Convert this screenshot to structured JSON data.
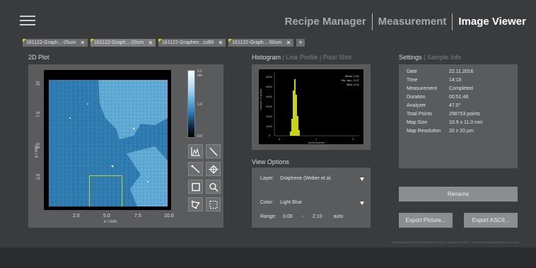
{
  "header": {
    "nav": [
      {
        "label": "Recipe Manager",
        "active": false
      },
      {
        "label": "Measurement",
        "active": false
      },
      {
        "label": "Image Viewer",
        "active": true
      }
    ]
  },
  "tabs": [
    {
      "label": "161122-Graph...-25um",
      "active": false
    },
    {
      "label": "161122-Graph...-20um",
      "active": true
    },
    {
      "label": "161122-Graphen...ssBlt",
      "active": false
    },
    {
      "label": "161122-Graph...-50um",
      "active": false
    }
  ],
  "tab_add_label": "+",
  "tab_close_label": "✕",
  "plot": {
    "title": "2D Plot",
    "y_ticks": [
      "10",
      "7.5",
      "5.0",
      "2.5"
    ],
    "x_ticks": [
      "2.5",
      "5.0",
      "7.5",
      "10.0"
    ],
    "y_title": "y / mm",
    "x_title": "x / mm",
    "colorbar_top": "2.1",
    "colorbar_unit": "nm",
    "colorbar_mid": "1.0",
    "colorbar_bottom": "0.0"
  },
  "histogram": {
    "tabs": [
      "Histogram",
      "Line Profile",
      "Pixel Shot"
    ],
    "stats": [
      "Mean: 0.01",
      "Std. dev.: 0.07",
      "Med: 0.01"
    ],
    "y_title": "Number of points",
    "x_title": "thickness/nm",
    "y_ticks": [
      "6000",
      "5000",
      "4000",
      "3000",
      "2000",
      "1000",
      "0"
    ],
    "x_ticks": [
      "0",
      "1",
      "2"
    ]
  },
  "view_options": {
    "title": "View Options",
    "layer_label": "Layer:",
    "layer_value": "Graphene (Weber et al.",
    "color_label": "Color:",
    "color_value": "Light Blue",
    "range_label": "Range:",
    "range_min": "0.00",
    "range_sep": "-",
    "range_max": "2.10",
    "range_mode": "auto"
  },
  "settings": {
    "tabs": [
      "Settings",
      "Sample Info"
    ],
    "rows": [
      {
        "key": "Date",
        "value": "22.11.2016"
      },
      {
        "key": "Time",
        "value": "14:15"
      },
      {
        "key": "Measurement",
        "value": "Completed"
      },
      {
        "key": "Duration",
        "value": "00:51:48"
      },
      {
        "key": "Analyzer",
        "value": "47.0°"
      },
      {
        "key": "Total Points",
        "value": "298753 points"
      },
      {
        "key": "Map Size",
        "value": "10.9 x 11.0 mm"
      },
      {
        "key": "Map Resolution",
        "value": "20 x 20 µm"
      }
    ]
  },
  "buttons": {
    "rename": "Rename",
    "export_picture": "Export Picture...",
    "export_ascii": "Export ASCII..."
  },
  "file_path": "M:\\Projekte\\DIS\\DIS-080\\Mf\\RHK\\01\\161122-Graphene-PSI03_Thermal-Treatment-Ref20l-20um.hlma",
  "colors": {
    "roi": "#c8d21a",
    "histogram_bars": "#c8d21a",
    "accent_tab": "#c5d419"
  }
}
